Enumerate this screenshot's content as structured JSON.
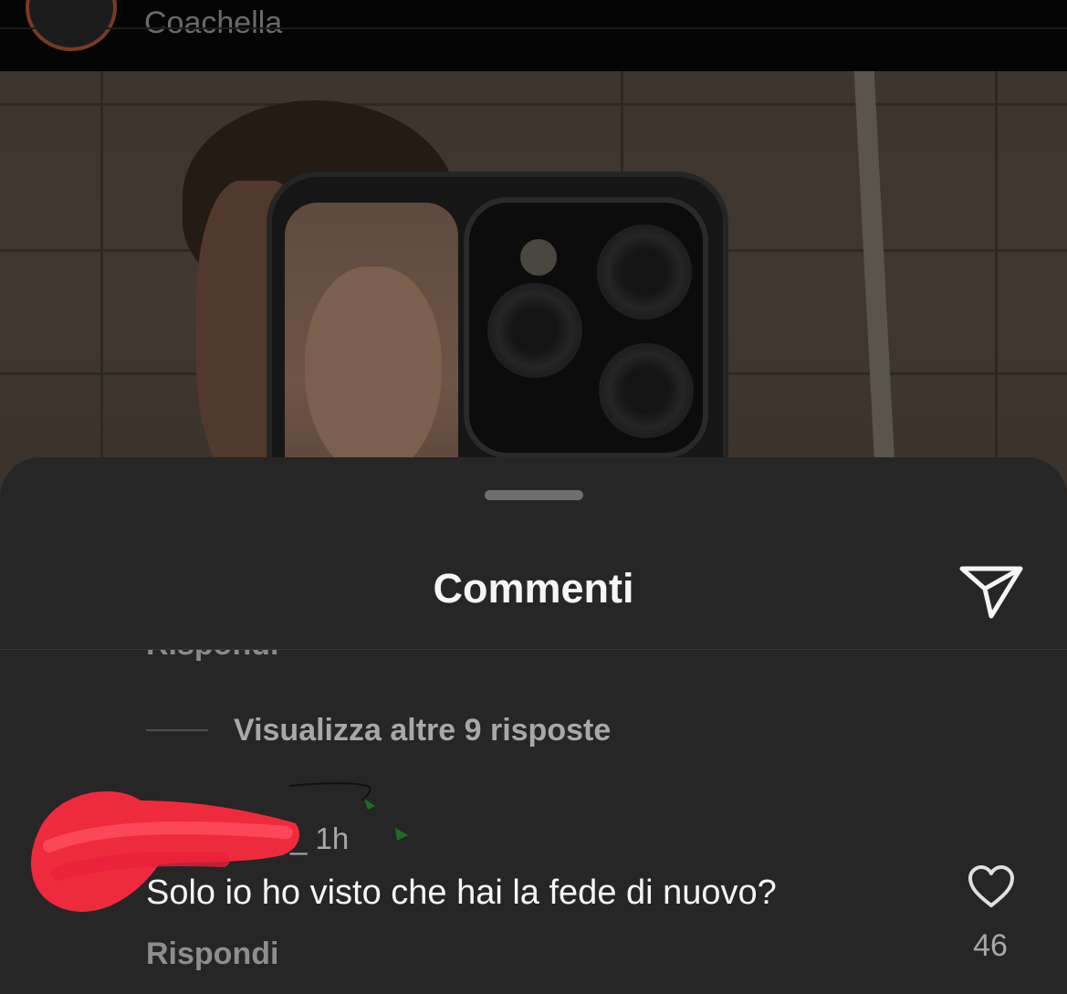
{
  "post": {
    "username": "Coachella"
  },
  "comments_sheet": {
    "title": "Commenti",
    "share_icon": "paper-plane-icon",
    "cut_reply_label": "Rispondi",
    "view_replies_label": "Visualizza altre 9 risposte",
    "comment": {
      "username_tail": "_",
      "time": "1h",
      "text": "Solo io ho visto che hai la fede di nuovo?",
      "reply_label": "Rispondi",
      "like_icon": "heart-outline-icon",
      "like_count": "46"
    }
  },
  "colors": {
    "sheet_bg": "#262626",
    "redaction": "#ff2b3f",
    "text_primary": "#f5f5f5",
    "text_secondary": "#a8a8a8"
  }
}
